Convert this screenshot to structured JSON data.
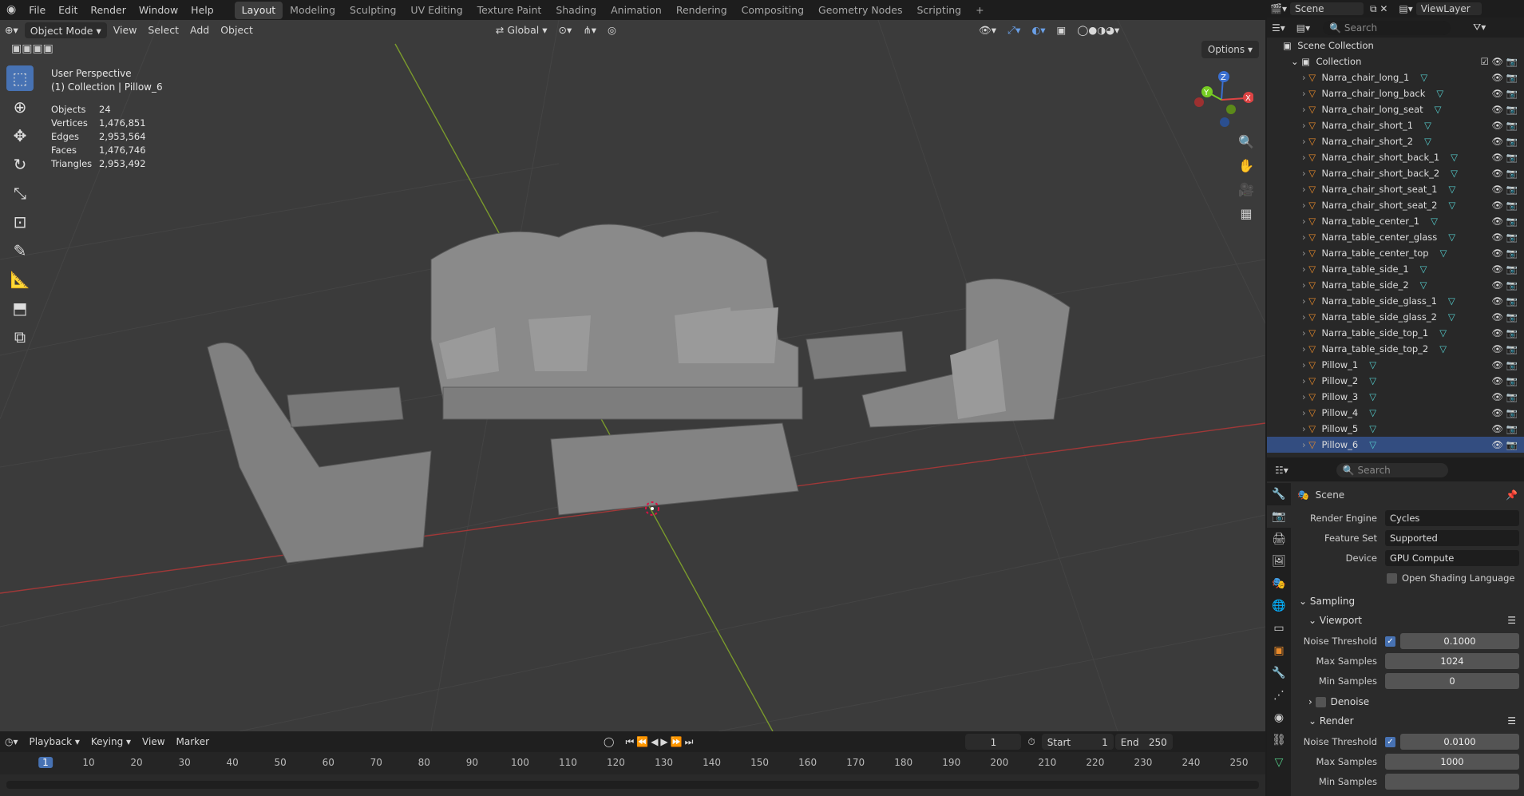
{
  "menu": {
    "items": [
      "File",
      "Edit",
      "Render",
      "Window",
      "Help"
    ]
  },
  "workspaces": [
    "Layout",
    "Modeling",
    "Sculpting",
    "UV Editing",
    "Texture Paint",
    "Shading",
    "Animation",
    "Rendering",
    "Compositing",
    "Geometry Nodes",
    "Scripting"
  ],
  "active_workspace": "Layout",
  "scene_name": "Scene",
  "view_layer": "ViewLayer",
  "viewport": {
    "mode": "Object Mode",
    "menus": [
      "View",
      "Select",
      "Add",
      "Object"
    ],
    "transform": "Global",
    "options_label": "Options",
    "title": "User Perspective",
    "subtitle": "(1) Collection | Pillow_6",
    "stats": [
      {
        "label": "Objects",
        "value": "24"
      },
      {
        "label": "Vertices",
        "value": "1,476,851"
      },
      {
        "label": "Edges",
        "value": "2,953,564"
      },
      {
        "label": "Faces",
        "value": "1,476,746"
      },
      {
        "label": "Triangles",
        "value": "2,953,492"
      }
    ],
    "gizmo": {
      "x": "X",
      "y": "Y",
      "z": "Z"
    }
  },
  "timeline": {
    "menus": [
      "Playback",
      "Keying",
      "View",
      "Marker"
    ],
    "current_frame": "1",
    "start_label": "Start",
    "start": "1",
    "end_label": "End",
    "end": "250",
    "ticks": [
      "1",
      "10",
      "20",
      "30",
      "40",
      "50",
      "60",
      "70",
      "80",
      "90",
      "100",
      "110",
      "120",
      "130",
      "140",
      "150",
      "160",
      "170",
      "180",
      "190",
      "200",
      "210",
      "220",
      "230",
      "240",
      "250"
    ]
  },
  "outliner": {
    "search_placeholder": "Search",
    "scene_collection": "Scene Collection",
    "collection": "Collection",
    "items": [
      "Narra_chair_long_1",
      "Narra_chair_long_back",
      "Narra_chair_long_seat",
      "Narra_chair_short_1",
      "Narra_chair_short_2",
      "Narra_chair_short_back_1",
      "Narra_chair_short_back_2",
      "Narra_chair_short_seat_1",
      "Narra_chair_short_seat_2",
      "Narra_table_center_1",
      "Narra_table_center_glass",
      "Narra_table_center_top",
      "Narra_table_side_1",
      "Narra_table_side_2",
      "Narra_table_side_glass_1",
      "Narra_table_side_glass_2",
      "Narra_table_side_top_1",
      "Narra_table_side_top_2",
      "Pillow_1",
      "Pillow_2",
      "Pillow_3",
      "Pillow_4",
      "Pillow_5",
      "Pillow_6"
    ]
  },
  "properties": {
    "search_placeholder": "Search",
    "context": "Scene",
    "render_engine_label": "Render Engine",
    "render_engine": "Cycles",
    "feature_set_label": "Feature Set",
    "feature_set": "Supported",
    "device_label": "Device",
    "device": "GPU Compute",
    "osl_label": "Open Shading Language",
    "sampling": "Sampling",
    "viewport_section": "Viewport",
    "noise_threshold_label": "Noise Threshold",
    "vp_noise": "0.1000",
    "max_samples_label": "Max Samples",
    "vp_max": "1024",
    "min_samples_label": "Min Samples",
    "vp_min": "0",
    "denoise": "Denoise",
    "render_section": "Render",
    "r_noise": "0.0100",
    "r_max": "1000",
    "r_min_label": "Min Samples"
  }
}
